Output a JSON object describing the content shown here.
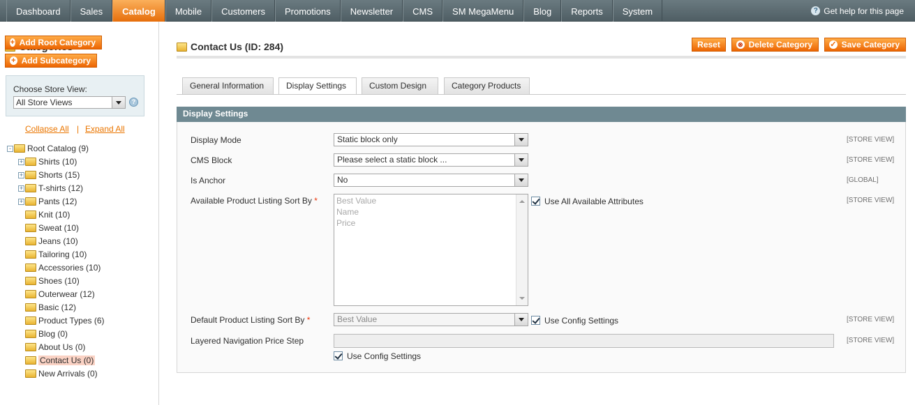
{
  "nav": {
    "items": [
      "Dashboard",
      "Sales",
      "Catalog",
      "Mobile",
      "Customers",
      "Promotions",
      "Newsletter",
      "CMS",
      "SM MegaMenu",
      "Blog",
      "Reports",
      "System"
    ],
    "active": "Catalog",
    "help": "Get help for this page"
  },
  "sidebar": {
    "title": "Categories",
    "add_root": "Add Root Category",
    "add_sub": "Add Subcategory",
    "store_label": "Choose Store View:",
    "store_value": "All Store Views",
    "collapse": "Collapse All",
    "separator": "|",
    "expand": "Expand All",
    "tree": [
      {
        "label": "Root Catalog (9)",
        "level": 0,
        "expander": "-"
      },
      {
        "label": "Shirts (10)",
        "level": 1,
        "expander": "+"
      },
      {
        "label": "Shorts (15)",
        "level": 1,
        "expander": "+"
      },
      {
        "label": "T-shirts (12)",
        "level": 1,
        "expander": "+"
      },
      {
        "label": "Pants (12)",
        "level": 1,
        "expander": "+"
      },
      {
        "label": "Knit (10)",
        "level": 1,
        "expander": ""
      },
      {
        "label": "Sweat (10)",
        "level": 1,
        "expander": ""
      },
      {
        "label": "Jeans (10)",
        "level": 1,
        "expander": ""
      },
      {
        "label": "Tailoring (10)",
        "level": 1,
        "expander": ""
      },
      {
        "label": "Accessories (10)",
        "level": 1,
        "expander": ""
      },
      {
        "label": "Shoes (10)",
        "level": 1,
        "expander": ""
      },
      {
        "label": "Outerwear (12)",
        "level": 1,
        "expander": ""
      },
      {
        "label": "Basic (12)",
        "level": 1,
        "expander": ""
      },
      {
        "label": "Product Types (6)",
        "level": 1,
        "expander": ""
      },
      {
        "label": "Blog (0)",
        "level": 1,
        "expander": ""
      },
      {
        "label": "About Us (0)",
        "level": 1,
        "expander": ""
      },
      {
        "label": "Contact Us (0)",
        "level": 1,
        "expander": "",
        "selected": true
      },
      {
        "label": "New Arrivals (0)",
        "level": 1,
        "expander": ""
      }
    ]
  },
  "main": {
    "title": "Contact Us (ID: 284)",
    "buttons": {
      "reset": "Reset",
      "delete": "Delete Category",
      "save": "Save Category"
    },
    "tabs": [
      "General Information",
      "Display Settings",
      "Custom Design",
      "Category Products"
    ],
    "active_tab": "Display Settings",
    "fieldset_title": "Display Settings",
    "fields": {
      "display_mode": {
        "label": "Display Mode",
        "value": "Static block only",
        "scope": "[STORE VIEW]"
      },
      "cms_block": {
        "label": "CMS Block",
        "value": "Please select a static block ...",
        "scope": "[STORE VIEW]"
      },
      "is_anchor": {
        "label": "Is Anchor",
        "value": "No",
        "scope": "[GLOBAL]"
      },
      "available_sort": {
        "label": "Available Product Listing Sort By",
        "required": "*",
        "options": [
          "Best Value",
          "Name",
          "Price"
        ],
        "checkbox": "Use All Available Attributes",
        "scope": "[STORE VIEW]"
      },
      "default_sort": {
        "label": "Default Product Listing Sort By",
        "required": "*",
        "value": "Best Value",
        "checkbox": "Use Config Settings",
        "scope": "[STORE VIEW]"
      },
      "price_step": {
        "label": "Layered Navigation Price Step",
        "checkbox": "Use Config Settings",
        "scope": "[STORE VIEW]"
      }
    }
  }
}
